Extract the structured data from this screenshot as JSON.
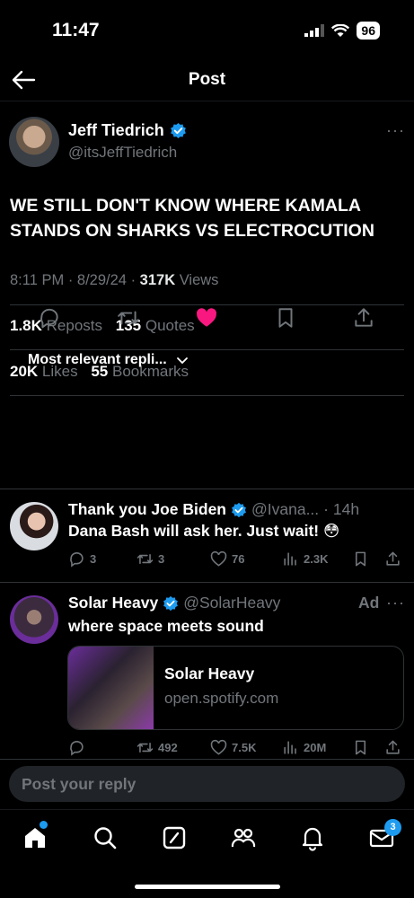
{
  "status": {
    "time": "11:47",
    "battery": "96"
  },
  "header": {
    "title": "Post"
  },
  "post": {
    "author_name": "Jeff Tiedrich",
    "author_handle": "@itsJeffTiedrich",
    "text": "WE STILL DON'T KNOW WHERE KAMALA STANDS ON SHARKS VS ELECTROCUTION",
    "time": "8:11 PM",
    "date": "8/29/24",
    "views_count": "317K",
    "views_label": "Views",
    "reposts_count": "1.8K",
    "reposts_label": "Reposts",
    "quotes_count": "135",
    "quotes_label": "Quotes",
    "likes_count": "20K",
    "likes_label": "Likes",
    "bookmarks_count": "55",
    "bookmarks_label": "Bookmarks",
    "more": "···",
    "meta_sep": "·"
  },
  "sort": {
    "label": "Most relevant repli..."
  },
  "replies": [
    {
      "name": "Thank you Joe Biden",
      "handle": "@Ivana...",
      "time": "· 14h",
      "text": "Dana Bash will ask her. Just wait! 😳",
      "reply_count": "3",
      "repost_count": "3",
      "like_count": "76",
      "view_count": "2.3K"
    },
    {
      "name": "Solar Heavy",
      "handle": "@SolarHeavy",
      "ad_label": "Ad",
      "text": "where space meets sound",
      "card_title": "Solar Heavy",
      "card_url": "open.spotify.com",
      "repost_count": "492",
      "like_count": "7.5K",
      "view_count": "20M"
    }
  ],
  "compose": {
    "placeholder": "Post your reply"
  },
  "tabbar": {
    "messages_badge": "3"
  },
  "colors": {
    "accent": "#1d9bf0",
    "like": "#f91880",
    "background": "#000000",
    "muted": "#71767b"
  },
  "icons": [
    "back-arrow-icon",
    "verified-icon",
    "more-icon",
    "reply-icon",
    "repost-icon",
    "like-icon",
    "bookmark-icon",
    "share-icon",
    "views-icon",
    "chevron-down-icon",
    "home-icon",
    "search-icon",
    "grok-icon",
    "communities-icon",
    "notifications-icon",
    "messages-icon"
  ]
}
